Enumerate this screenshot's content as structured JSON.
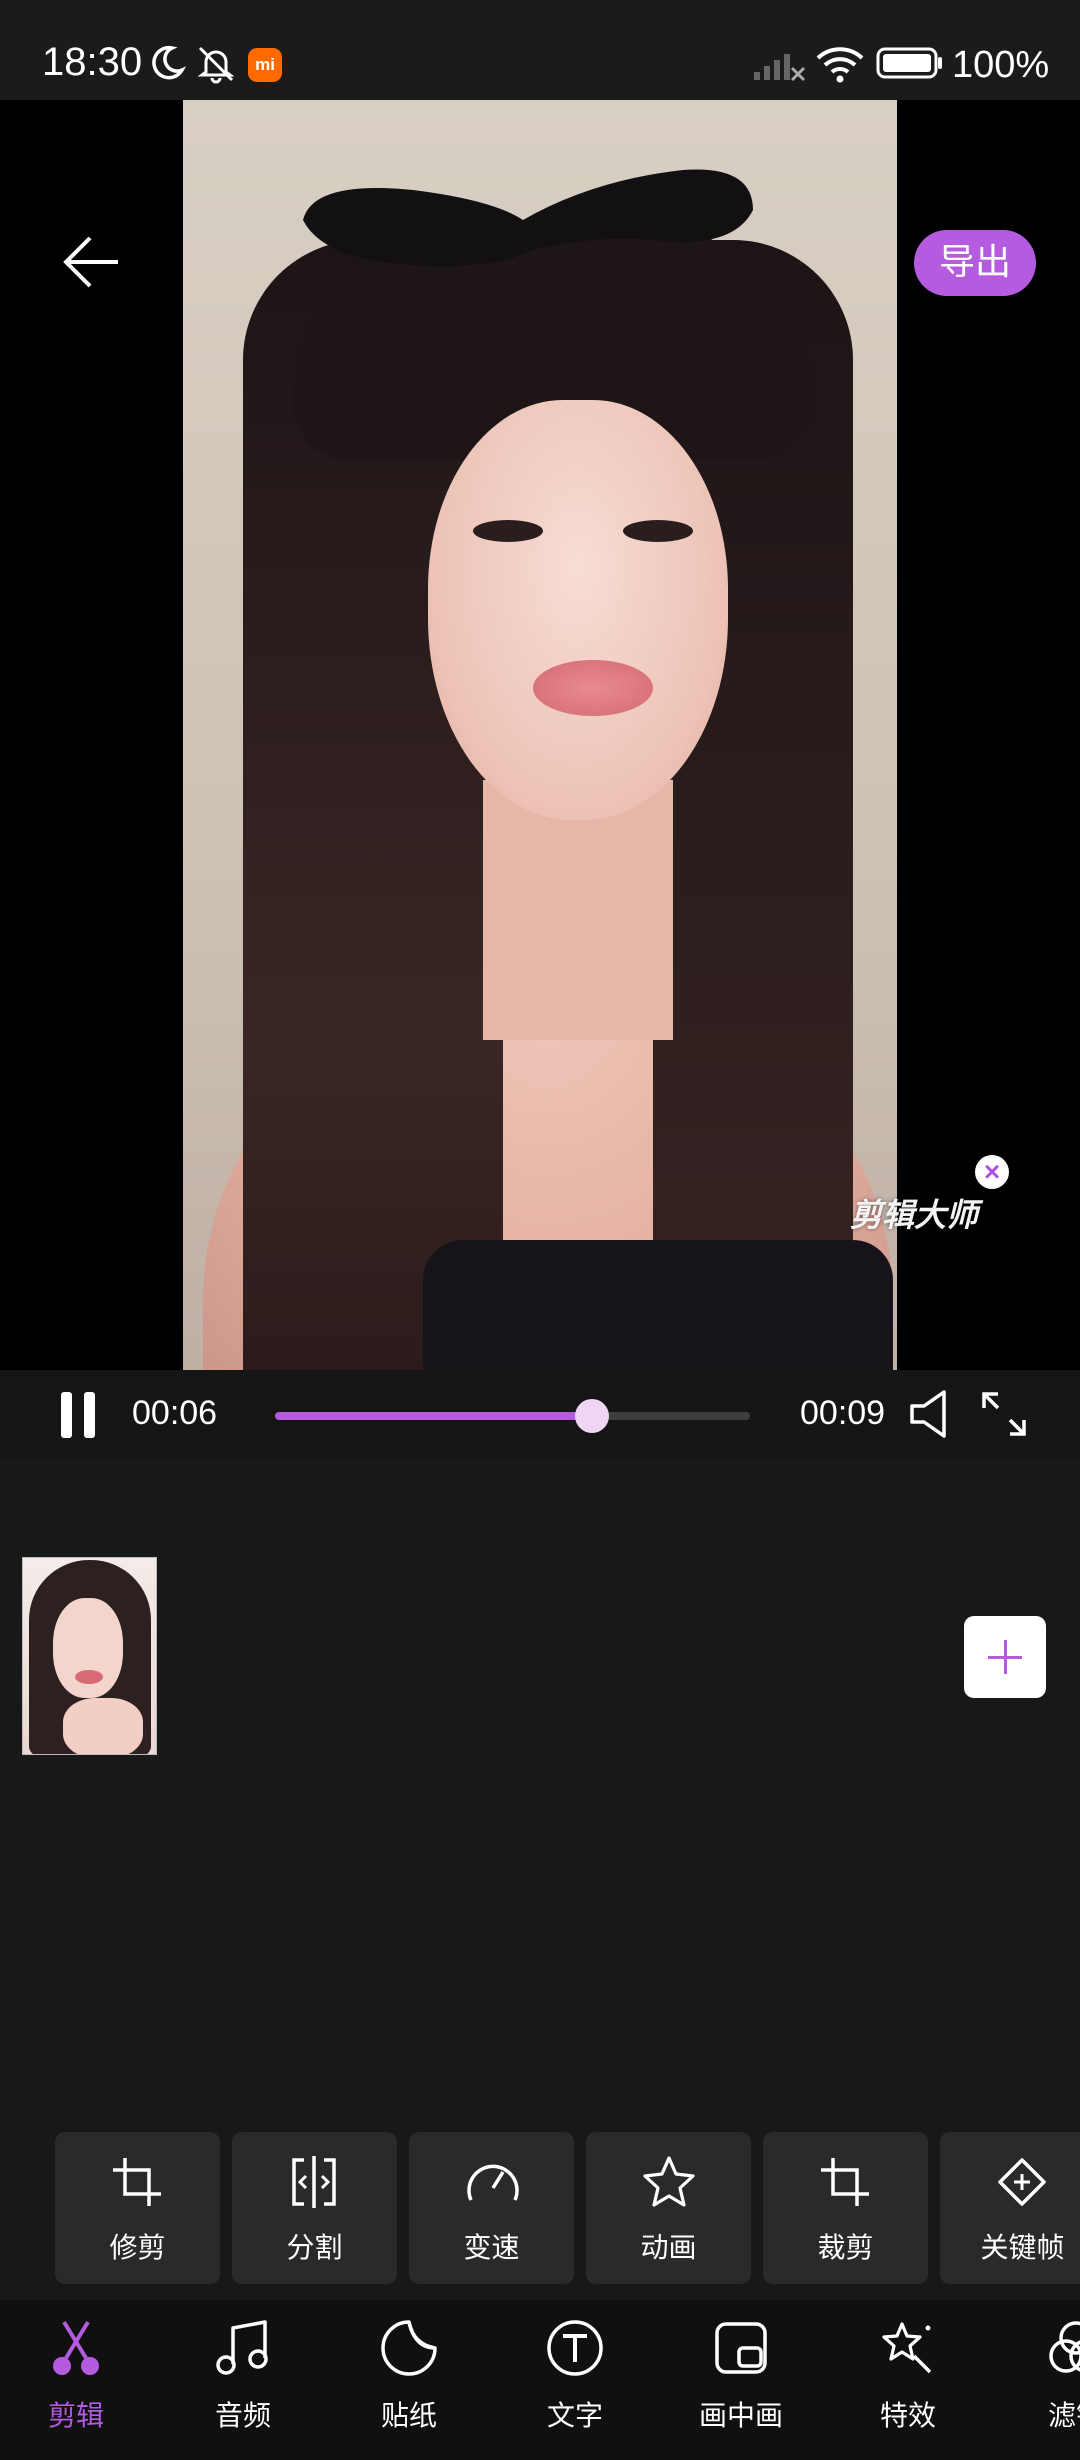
{
  "status_bar": {
    "time": "18:30",
    "mi_badge": "mi",
    "battery": "100%"
  },
  "header": {
    "export_label": "导出"
  },
  "video": {
    "watermark": "剪辑大师"
  },
  "player": {
    "current_time": "00:06",
    "total_time": "00:09",
    "progress": 0.667
  },
  "tools": [
    {
      "label": "修剪",
      "icon": "trim-icon"
    },
    {
      "label": "分割",
      "icon": "split-icon"
    },
    {
      "label": "变速",
      "icon": "speed-icon"
    },
    {
      "label": "动画",
      "icon": "animation-star-icon"
    },
    {
      "label": "裁剪",
      "icon": "crop-icon"
    },
    {
      "label": "关键帧",
      "icon": "keyframe-icon"
    }
  ],
  "nav": [
    {
      "label": "剪辑",
      "icon": "scissors-icon",
      "active": true
    },
    {
      "label": "音频",
      "icon": "music-note-icon"
    },
    {
      "label": "贴纸",
      "icon": "sticker-icon"
    },
    {
      "label": "文字",
      "icon": "text-icon"
    },
    {
      "label": "画中画",
      "icon": "picture-in-picture-icon"
    },
    {
      "label": "特效",
      "icon": "effects-icon"
    },
    {
      "label": "滤镜",
      "icon": "filter-icon"
    }
  ],
  "colors": {
    "accent": "#b55be0",
    "background": "#181818"
  }
}
